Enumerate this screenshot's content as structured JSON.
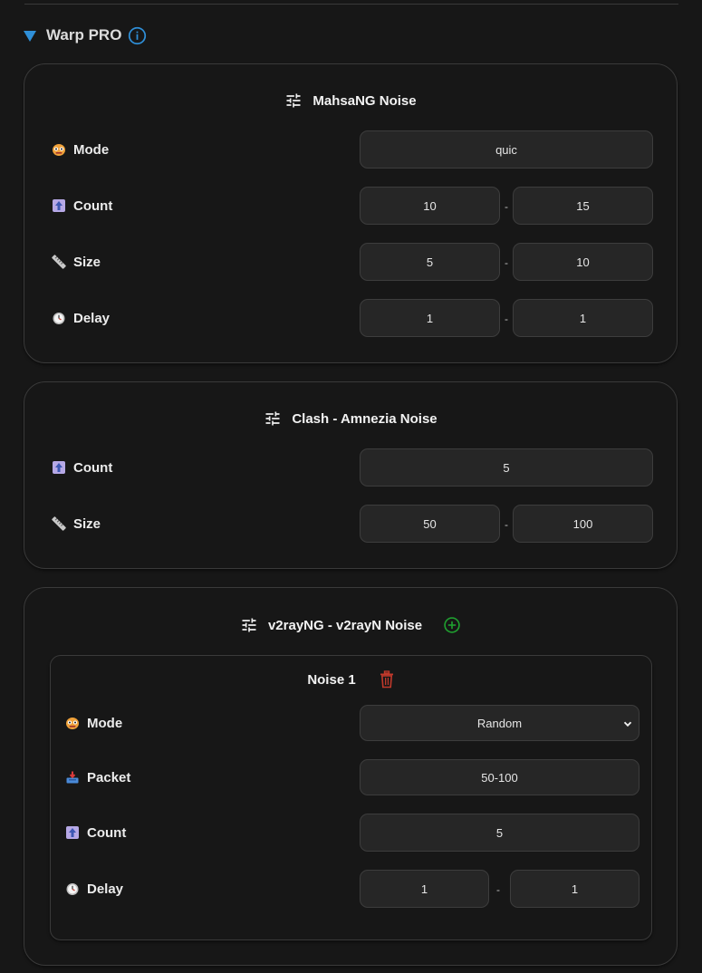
{
  "section": {
    "title": "Warp PRO"
  },
  "mahsang": {
    "title": "MahsaNG Noise",
    "mode": {
      "label": "Mode",
      "value": "quic"
    },
    "count": {
      "label": "Count",
      "min": "10",
      "max": "15"
    },
    "size": {
      "label": "Size",
      "min": "5",
      "max": "10"
    },
    "delay": {
      "label": "Delay",
      "min": "1",
      "max": "1"
    },
    "separator": "-"
  },
  "clash": {
    "title": "Clash - Amnezia Noise",
    "count": {
      "label": "Count",
      "value": "5"
    },
    "size": {
      "label": "Size",
      "min": "50",
      "max": "100"
    },
    "separator": "-"
  },
  "v2ray": {
    "title": "v2rayNG - v2rayN Noise",
    "noise1": {
      "title": "Noise 1",
      "mode": {
        "label": "Mode",
        "value": "Random"
      },
      "packet": {
        "label": "Packet",
        "value": "50-100"
      },
      "count": {
        "label": "Count",
        "value": "5"
      },
      "delay": {
        "label": "Delay",
        "min": "1",
        "max": "1"
      },
      "separator": "-"
    }
  },
  "colors": {
    "accent": "#2f8fd8",
    "add": "#1f9d2f",
    "delete": "#c0392b",
    "field_bg": "#262626",
    "page_bg": "#171717"
  }
}
